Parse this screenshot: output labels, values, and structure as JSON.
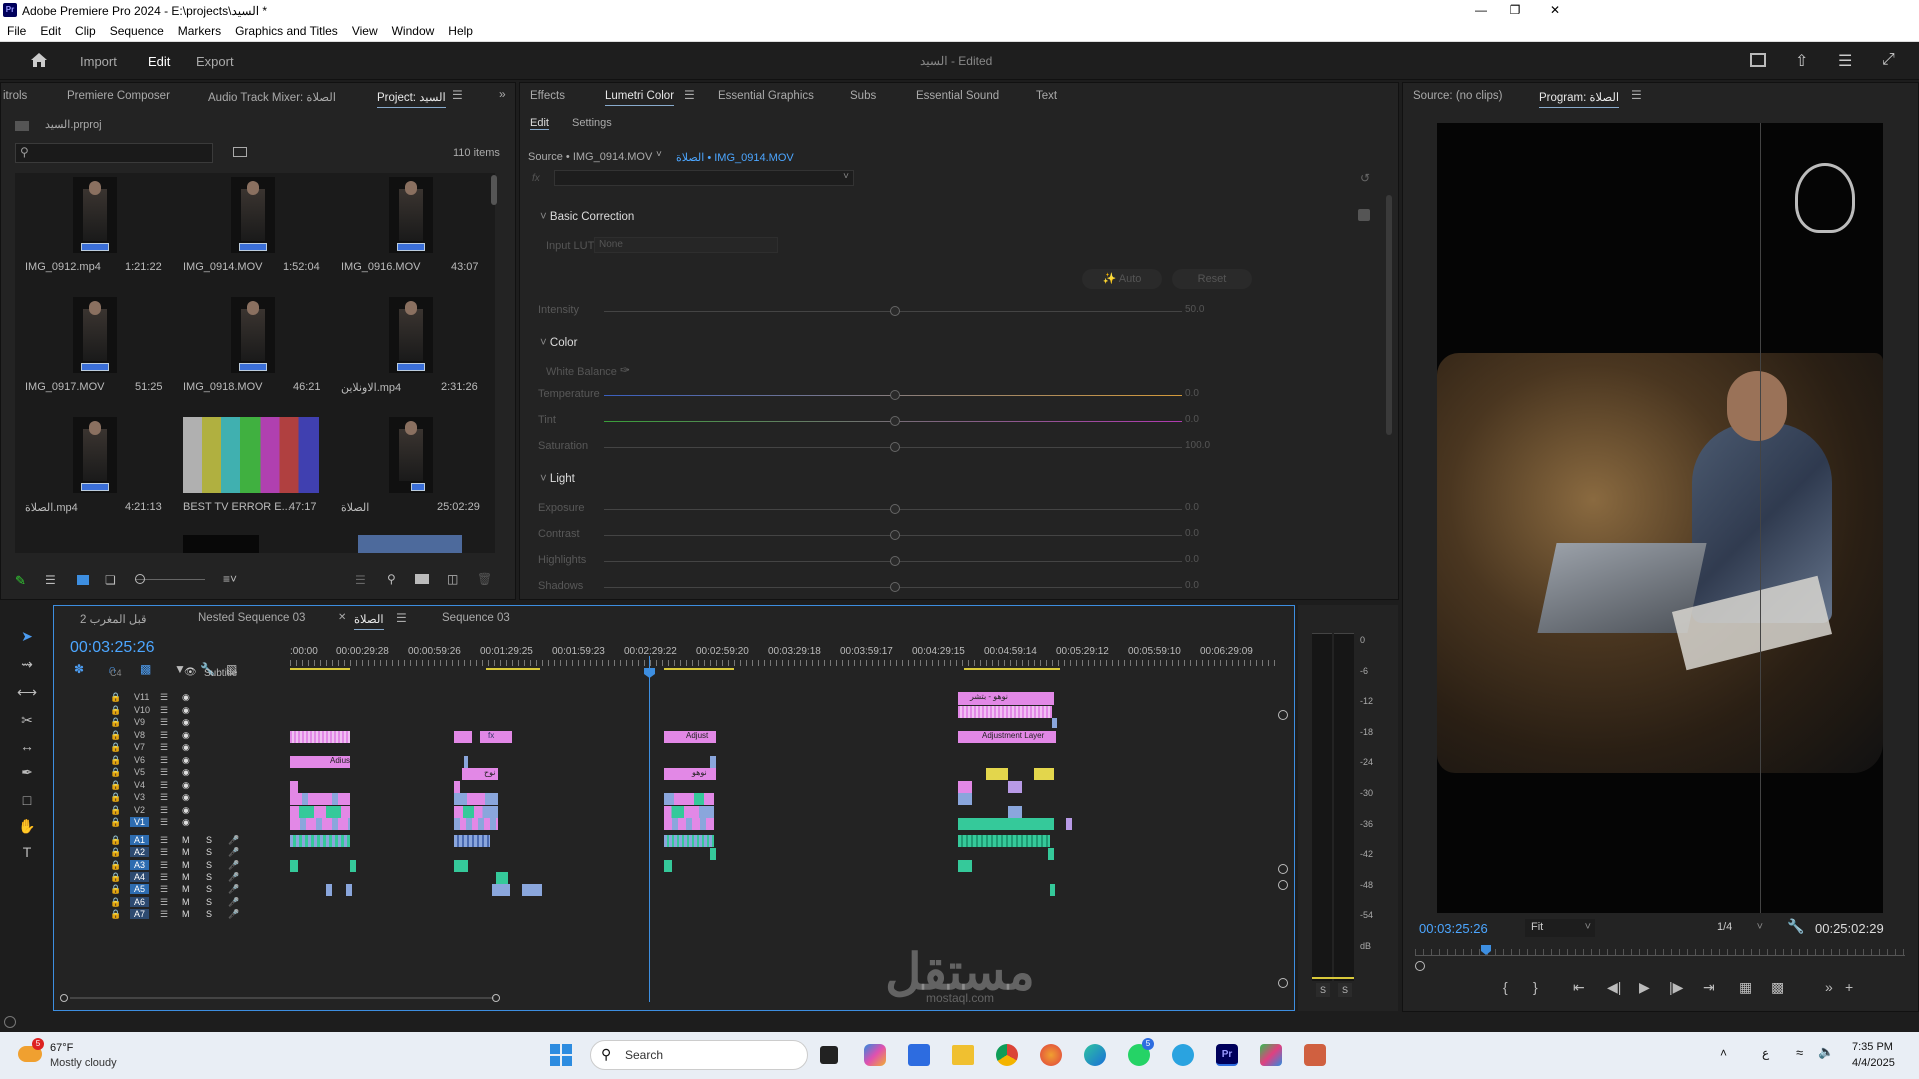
{
  "window": {
    "title": "Adobe Premiere Pro 2024 - E:\\projects\\السيد *",
    "app_icon": "Pr"
  },
  "menu": [
    "File",
    "Edit",
    "Clip",
    "Sequence",
    "Markers",
    "Graphics and Titles",
    "View",
    "Window",
    "Help"
  ],
  "header": {
    "tabs": [
      "Import",
      "Edit",
      "Export"
    ],
    "active_tab": "Edit",
    "center_title": "السيد",
    "center_status": "- Edited"
  },
  "left_panel": {
    "tabs": [
      "itrols",
      "Premiere Composer",
      "Audio Track Mixer: الصلاة",
      "Project: السيد"
    ],
    "active_tab": "Project: السيد",
    "project_file": "السيد.prproj",
    "item_count": "110 items",
    "items": [
      {
        "name": "IMG_0912.mp4",
        "duration": "1:21:22"
      },
      {
        "name": "IMG_0914.MOV",
        "duration": "1:52:04"
      },
      {
        "name": "IMG_0916.MOV",
        "duration": "43:07"
      },
      {
        "name": "IMG_0917.MOV",
        "duration": "51:25"
      },
      {
        "name": "IMG_0918.MOV",
        "duration": "46:21"
      },
      {
        "name": "الاونلاين.mp4",
        "duration": "2:31:26"
      },
      {
        "name": "الصلاة.mp4",
        "duration": "4:21:13"
      },
      {
        "name": "BEST TV ERROR E...",
        "duration": "47:17"
      },
      {
        "name": "الصلاة",
        "duration": "25:02:29"
      }
    ]
  },
  "lumetri": {
    "tabs": [
      "Effects",
      "Lumetri Color",
      "Essential Graphics",
      "Subs",
      "Essential Sound",
      "Text"
    ],
    "active_tab": "Lumetri Color",
    "subtabs": [
      "Edit",
      "Settings"
    ],
    "source_label": "Source • IMG_0914.MOV",
    "sequence_label": "الصلاة • IMG_0914.MOV",
    "fx_label": "fx",
    "sections": {
      "basic": "Basic Correction",
      "input_lut_label": "Input LUT",
      "input_lut_value": "None",
      "auto_btn": "Auto",
      "reset_btn": "Reset",
      "intensity_label": "Intensity",
      "intensity_value": "50.0",
      "color": "Color",
      "white_balance": "White Balance",
      "sliders": [
        {
          "label": "Temperature",
          "value": "0.0"
        },
        {
          "label": "Tint",
          "value": "0.0"
        },
        {
          "label": "Saturation",
          "value": "100.0"
        }
      ],
      "light": "Light",
      "light_sliders": [
        {
          "label": "Exposure",
          "value": "0.0"
        },
        {
          "label": "Contrast",
          "value": "0.0"
        },
        {
          "label": "Highlights",
          "value": "0.0"
        },
        {
          "label": "Shadows",
          "value": "0.0"
        }
      ]
    }
  },
  "monitor": {
    "source_tab": "Source: (no clips)",
    "program_tab": "Program: الصلاة",
    "timecode": "00:03:25:26",
    "fit": "Fit",
    "resolution": "1/4",
    "duration": "00:25:02:29",
    "playhead_fraction": 0.137
  },
  "timeline": {
    "tabs": [
      "قبل المغرب 2",
      "Nested Sequence 03",
      "الصلاة",
      "Sequence 03"
    ],
    "active_tab": "الصلاة",
    "timecode": "00:03:25:26",
    "ruler": [
      ":00:00",
      "00:00:29:28",
      "00:00:59:26",
      "00:01:29:25",
      "00:01:59:23",
      "00:02:29:22",
      "00:02:59:20",
      "00:03:29:18",
      "00:03:59:17",
      "00:04:29:15",
      "00:04:59:14",
      "00:05:29:12",
      "00:05:59:10",
      "00:06:29:09"
    ],
    "subtitle_label": "Subtitle",
    "c4_label": "C4",
    "video_tracks": [
      "V11",
      "V10",
      "V9",
      "V8",
      "V7",
      "V6",
      "V5",
      "V4",
      "V3",
      "V2",
      "V1"
    ],
    "audio_tracks": [
      "A1",
      "A2",
      "A3",
      "A4",
      "A5",
      "A6",
      "A7"
    ],
    "mute_label": "M",
    "solo_label": "S",
    "clip_labels": {
      "adjust": "Adjust",
      "adjust_layer": "Adjustment Layer",
      "adius": "Adius",
      "fx": "fx",
      "nawh": "نوح",
      "nawhou": "نوهو",
      "taskbar_top": "نوهو - بتشر"
    }
  },
  "meter": {
    "scale": [
      "0",
      "-6",
      "-12",
      "-18",
      "-24",
      "-30",
      "-36",
      "-42",
      "-48",
      "-54",
      "dB"
    ],
    "solo_buttons": [
      "S",
      "S"
    ]
  },
  "watermark": {
    "text": "مستقل",
    "url": "mostaql.com"
  },
  "taskbar": {
    "weather_temp": "67°F",
    "weather_desc": "Mostly cloudy",
    "weather_badge": "5",
    "search_placeholder": "Search",
    "whatsapp_badge": "5",
    "time": "7:35 PM",
    "date": "4/4/2025",
    "lang": "ع"
  },
  "colors": {
    "accent": "#3d8ee0",
    "clip_pink": "#e288e6",
    "clip_blue": "#8aa6dc",
    "clip_green": "#35c99a",
    "clip_yellow": "#e3d64c",
    "timecode_blue": "#4ca6ff"
  }
}
